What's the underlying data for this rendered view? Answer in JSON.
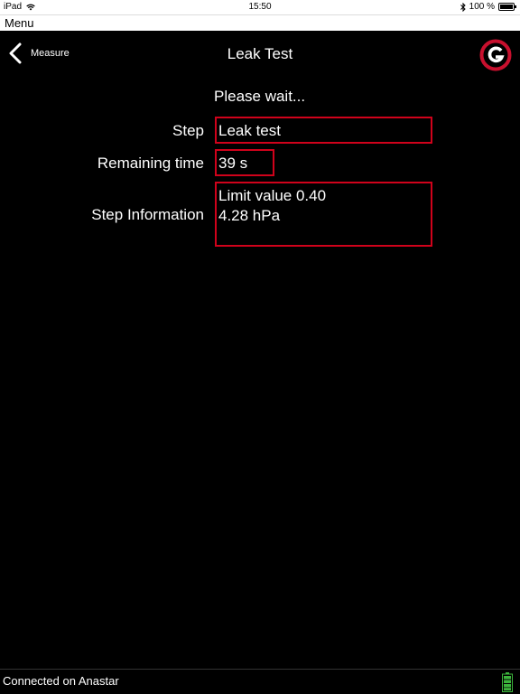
{
  "status_bar": {
    "device": "iPad",
    "time": "15:50",
    "battery_percent": "100 %"
  },
  "menu_bar": {
    "label": "Menu"
  },
  "nav": {
    "back_label": "Measure",
    "title": "Leak Test"
  },
  "main": {
    "wait_message": "Please wait...",
    "step": {
      "label": "Step",
      "value": "Leak test"
    },
    "remaining": {
      "label": "Remaining time",
      "value": "39 s"
    },
    "info": {
      "label": "Step Information",
      "lines": [
        "Limit value 0.40",
        "4.28 hPa"
      ]
    }
  },
  "footer": {
    "connection": "Connected on Anastar"
  },
  "colors": {
    "accent": "#d0021b",
    "logo": "#c8102e",
    "battery": "#3cb43c"
  }
}
